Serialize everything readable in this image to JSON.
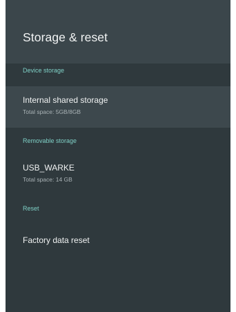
{
  "header": {
    "title": "Storage & reset"
  },
  "sections": [
    {
      "header": "Device storage",
      "items": [
        {
          "title": "Internal shared storage",
          "subtitle": "Total space: 5GB/8GB",
          "focused": true
        }
      ]
    },
    {
      "header": "Removable storage",
      "items": [
        {
          "title": "USB_WARKE",
          "subtitle": "Total space: 14 GB",
          "focused": false
        }
      ]
    },
    {
      "header": "Reset",
      "items": [
        {
          "title": "Factory data reset",
          "subtitle": "",
          "focused": false
        }
      ]
    }
  ],
  "colors": {
    "background": "#2f393d",
    "header_background": "#3b464b",
    "focused_row": "#3d484d",
    "section_header_accent": "#7fd0c6",
    "primary_text": "#f0f2f2",
    "secondary_text": "#aab3b6"
  }
}
